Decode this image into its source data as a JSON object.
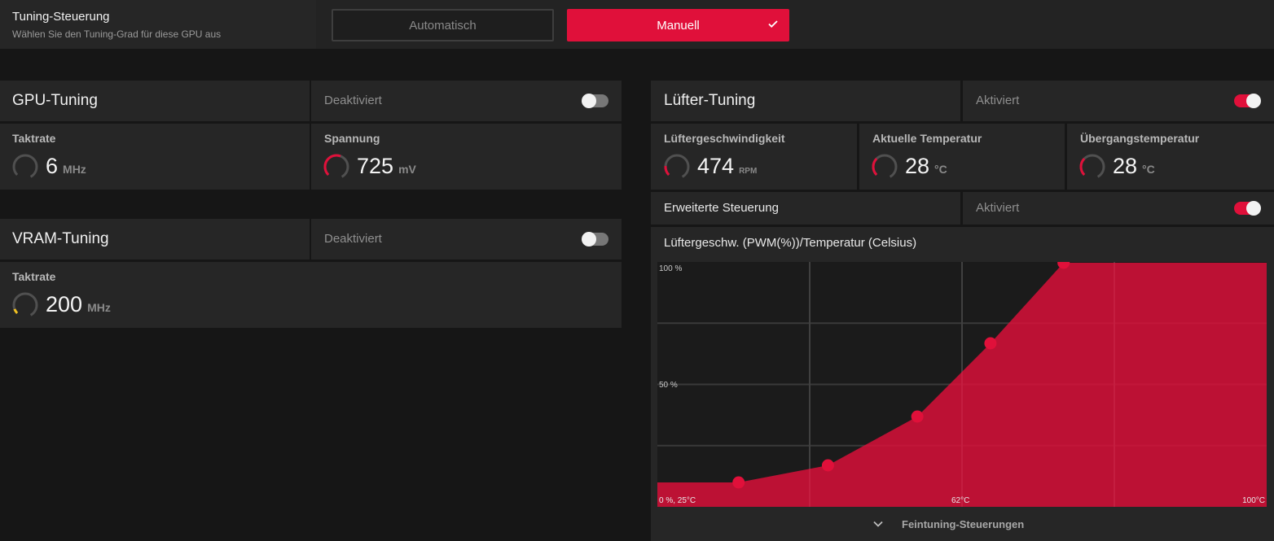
{
  "tuning_control": {
    "title": "Tuning-Steuerung",
    "subtitle": "Wählen Sie den Tuning-Grad für diese GPU aus",
    "auto_label": "Automatisch",
    "manual_label": "Manuell",
    "selected": "Manuell",
    "check_icon": "check-icon"
  },
  "gpu_tuning": {
    "title": "GPU-Tuning",
    "status": "Deaktiviert",
    "enabled": false,
    "clock": {
      "label": "Taktrate",
      "value": "6",
      "unit": "MHz"
    },
    "voltage": {
      "label": "Spannung",
      "value": "725",
      "unit": "mV"
    }
  },
  "vram_tuning": {
    "title": "VRAM-Tuning",
    "status": "Deaktiviert",
    "enabled": false,
    "clock": {
      "label": "Taktrate",
      "value": "200",
      "unit": "MHz"
    }
  },
  "fan_tuning": {
    "title": "Lüfter-Tuning",
    "status": "Aktiviert",
    "enabled": true,
    "fan_speed": {
      "label": "Lüftergeschwindigkeit",
      "value": "474",
      "unit": "RPM"
    },
    "current_temp": {
      "label": "Aktuelle Temperatur",
      "value": "28",
      "unit": "°C"
    },
    "junction_temp": {
      "label": "Übergangstemperatur",
      "value": "28",
      "unit": "°C"
    },
    "advanced": {
      "label": "Erweiterte Steuerung",
      "status": "Aktiviert",
      "enabled": true
    },
    "curve_title": "Lüftergeschw. (PWM(%))/Temperatur (Celsius)",
    "fine_tuning_label": "Feintuning-Steuerungen"
  },
  "colors": {
    "accent": "#e0103a",
    "panel": "#262626",
    "background": "#161616",
    "vram_gauge": "#f0c020"
  },
  "chart_data": {
    "type": "area",
    "title": "Lüftergeschw. (PWM(%))/Temperatur (Celsius)",
    "x_unit": "Celsius",
    "y_unit": "PWM(%)",
    "xlim": [
      25,
      100
    ],
    "ylim": [
      0,
      100
    ],
    "tick_labels": {
      "y_top": "100 %",
      "y_mid": "50 %",
      "origin": "0 %, 25°C",
      "x_mid": "62°C",
      "x_max": "100°C"
    },
    "points": [
      {
        "x": 35,
        "y": 10
      },
      {
        "x": 46,
        "y": 17
      },
      {
        "x": 57,
        "y": 37
      },
      {
        "x": 66,
        "y": 67
      },
      {
        "x": 75,
        "y": 100
      }
    ],
    "grid": true
  }
}
